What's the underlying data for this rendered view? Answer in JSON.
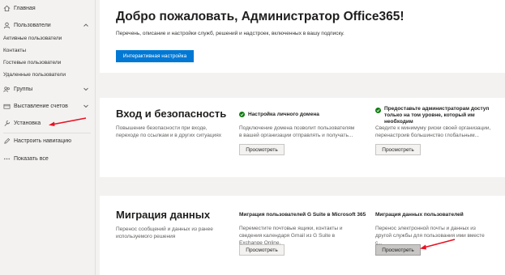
{
  "sidebar": {
    "items": [
      {
        "label": "Главная",
        "icon": "home-icon"
      },
      {
        "label": "Пользователи",
        "icon": "person-icon"
      },
      {
        "label": "Группы",
        "icon": "group-icon"
      },
      {
        "label": "Выставление счетов",
        "icon": "billing-icon"
      },
      {
        "label": "Установка",
        "icon": "wrench-icon"
      },
      {
        "label": "Настроить навигацию",
        "icon": "pencil-icon"
      },
      {
        "label": "Показать все",
        "icon": "ellipsis-icon"
      }
    ],
    "users_sub": [
      "Активные пользователи",
      "Контакты",
      "Гостевые пользователи",
      "Удаленные пользователи"
    ]
  },
  "welcome": {
    "title": "Добро пожаловать, Администратор Office365!",
    "description": "Перечень, описание и настройки служб, решений и надстроек, включенных в вашу подписку.",
    "button": "Интерактивная настройка"
  },
  "security": {
    "title": "Вход и безопасность",
    "description": "Повышение безопасности при входе, переходе по ссылкам и в других ситуациях",
    "cards": [
      {
        "title": "Настройка личного домена",
        "description": "Подключение домена позволит пользователям в вашей организации отправлять и получать...",
        "button": "Просмотреть"
      },
      {
        "title": "Предоставьте администраторам доступ только на том уровне, который им необходим",
        "description": "Сведите к минимуму риски своей организации, перенастроив большинство глобальным...",
        "button": "Просмотреть"
      }
    ]
  },
  "migration": {
    "title": "Миграция данных",
    "description": "Перенос сообщений и данных из ранее используемого решения",
    "cards": [
      {
        "title": "Миграция пользователей G Suite в Microsoft 365",
        "description": "Переместите почтовые ящики, контакты и сведения календаря Gmail из G Suite в Exchange Online.",
        "button": "Просмотреть"
      },
      {
        "title": "Миграция данных пользователей",
        "description": "Перенос электронной почты и данных из другой службы для пользования ими вместе с...",
        "button": "Просмотреть"
      }
    ]
  },
  "colors": {
    "accent": "#0078d4",
    "check": "#107c10",
    "annotation_arrow": "#e81123"
  }
}
